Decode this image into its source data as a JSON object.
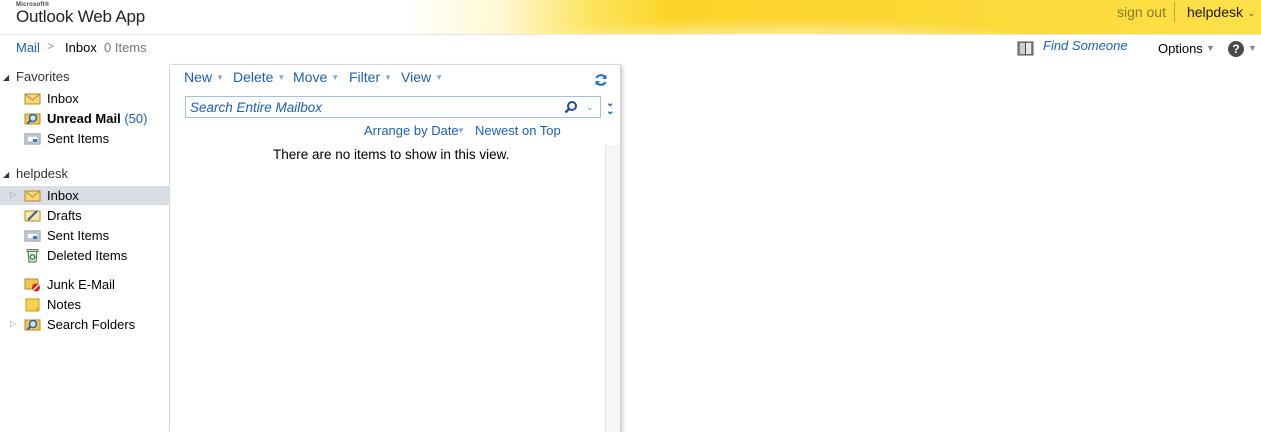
{
  "header": {
    "brand_small": "Microsoft®",
    "app_title": "Outlook Web App",
    "sign_out": "sign out",
    "user": "helpdesk"
  },
  "breadcrumb": {
    "mail": "Mail",
    "separator": ">",
    "folder": "Inbox",
    "count": "0 Items"
  },
  "top_right": {
    "find_someone": "Find Someone",
    "options": "Options",
    "help": "?"
  },
  "nav": {
    "favorites": {
      "label": "Favorites",
      "items": [
        {
          "label": "Inbox",
          "icon": "inbox-icon"
        },
        {
          "label": "Unread Mail",
          "count": "50",
          "icon": "search-folder-icon"
        },
        {
          "label": "Sent Items",
          "icon": "sent-items-icon"
        }
      ]
    },
    "mailbox": {
      "label": "helpdesk",
      "items": [
        {
          "label": "Inbox",
          "icon": "inbox-icon",
          "selected": true
        },
        {
          "label": "Drafts",
          "icon": "drafts-icon"
        },
        {
          "label": "Sent Items",
          "icon": "sent-items-icon"
        },
        {
          "label": "Deleted Items",
          "icon": "recycle-bin-icon"
        },
        {
          "label": "Junk E-Mail",
          "icon": "junk-icon"
        },
        {
          "label": "Notes",
          "icon": "notes-icon"
        },
        {
          "label": "Search Folders",
          "icon": "search-folder-icon"
        }
      ]
    }
  },
  "toolbar": {
    "new": "New",
    "delete": "Delete",
    "move": "Move",
    "filter": "Filter",
    "view": "View"
  },
  "search": {
    "placeholder": "Search Entire Mailbox"
  },
  "list": {
    "arrange_by": "Arrange by Date",
    "sort_order": "Newest on Top",
    "empty_message": "There are no items to show in this view."
  },
  "colors": {
    "link": "#1b5fb8",
    "header_yellow": "#fbd52a",
    "selected_row": "#d9dee4"
  }
}
